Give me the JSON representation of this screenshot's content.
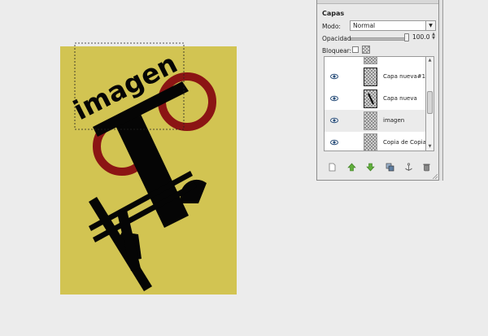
{
  "canvas": {
    "image_word": "imagen",
    "background_color": "#d2c452",
    "ring_color": "#8b1514",
    "shape_color": "#050505"
  },
  "layers_dock": {
    "title": "Capas",
    "mode_label": "Modo:",
    "mode_value": "Normal",
    "opacity_label": "Opacidad:",
    "opacity_value": "100.0",
    "lock_label": "Bloquear:",
    "layers": [
      {
        "name": "Capa nueva#1",
        "visible": true,
        "selected": false
      },
      {
        "name": "Capa nueva",
        "visible": true,
        "selected": false
      },
      {
        "name": "imagen",
        "visible": true,
        "selected": true
      },
      {
        "name": "Copia de Copia de",
        "visible": true,
        "selected": false
      }
    ],
    "toolbar_icons": [
      "new-layer-icon",
      "raise-layer-icon",
      "lower-layer-icon",
      "duplicate-layer-icon",
      "anchor-layer-icon",
      "delete-layer-icon"
    ]
  }
}
